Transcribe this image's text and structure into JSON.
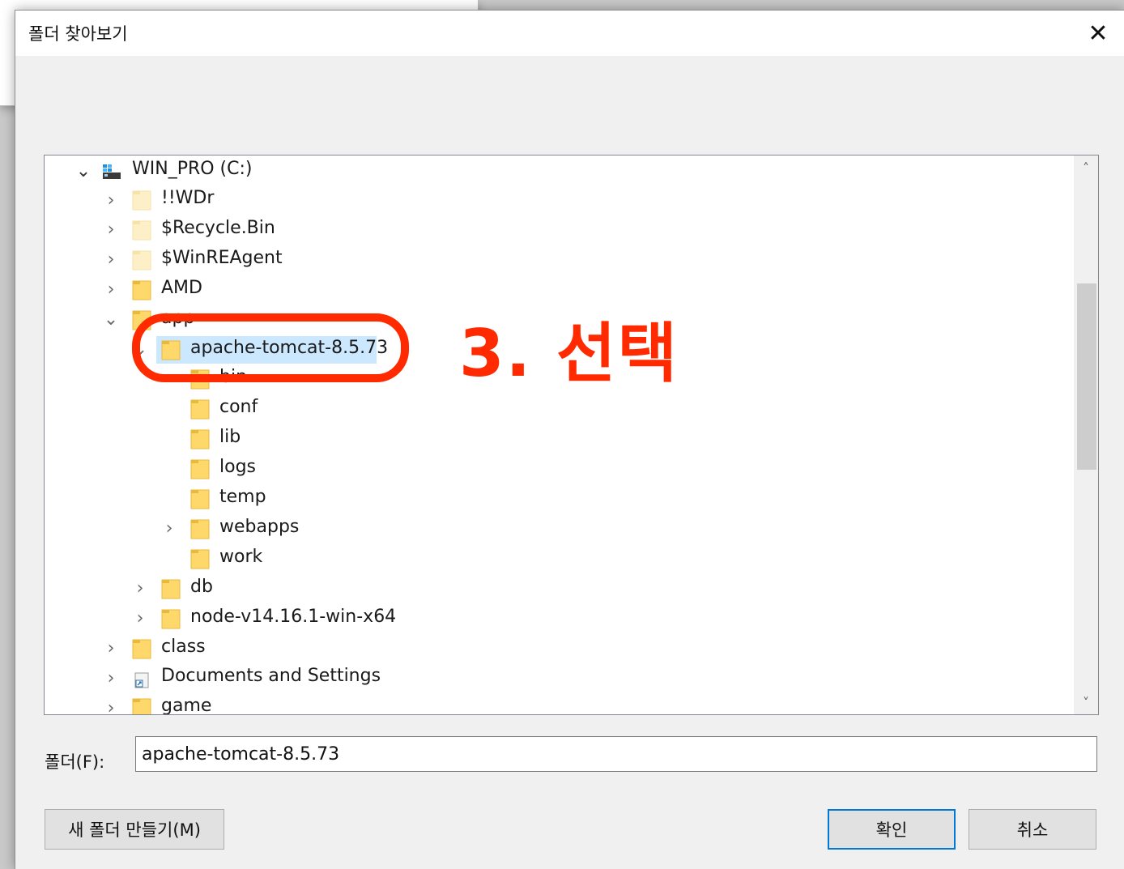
{
  "dialog": {
    "title": "폴더 찾아보기",
    "close_glyph": "✕"
  },
  "tree": {
    "drive": {
      "label": "WIN_PRO (C:)",
      "icon": "drive-icon"
    },
    "items": [
      {
        "label": "!!WDr",
        "expander": "›",
        "icon": "folder-hidden-icon"
      },
      {
        "label": "$Recycle.Bin",
        "expander": "›",
        "icon": "folder-hidden-icon"
      },
      {
        "label": "$WinREAgent",
        "expander": "›",
        "icon": "folder-hidden-icon"
      },
      {
        "label": "AMD",
        "expander": "›",
        "icon": "folder-icon"
      },
      {
        "label": "app",
        "expander": "⌄",
        "icon": "folder-icon"
      },
      {
        "label": "apache-tomcat-8.5.73",
        "expander": "⌄",
        "icon": "folder-icon",
        "selected": true
      },
      {
        "label": "bin",
        "expander": "",
        "icon": "folder-icon"
      },
      {
        "label": "conf",
        "expander": "",
        "icon": "folder-icon"
      },
      {
        "label": "lib",
        "expander": "",
        "icon": "folder-icon"
      },
      {
        "label": "logs",
        "expander": "",
        "icon": "folder-icon"
      },
      {
        "label": "temp",
        "expander": "",
        "icon": "folder-icon"
      },
      {
        "label": "webapps",
        "expander": "›",
        "icon": "folder-icon"
      },
      {
        "label": "work",
        "expander": "",
        "icon": "folder-icon"
      },
      {
        "label": "db",
        "expander": "›",
        "icon": "folder-icon"
      },
      {
        "label": "node-v14.16.1-win-x64",
        "expander": "›",
        "icon": "folder-icon"
      },
      {
        "label": "class",
        "expander": "›",
        "icon": "folder-icon"
      },
      {
        "label": "Documents and Settings",
        "expander": "›",
        "icon": "shortcut-folder-icon"
      },
      {
        "label": "game",
        "expander": "›",
        "icon": "folder-icon"
      }
    ],
    "scroll_up": "˄",
    "scroll_down": "˅"
  },
  "folder_field": {
    "label": "폴더(F):",
    "value": "apache-tomcat-8.5.73"
  },
  "buttons": {
    "new_folder": "새 폴더 만들기(M)",
    "ok": "확인",
    "cancel": "취소"
  },
  "annotation": {
    "text": "3. 선택",
    "color": "#ff2a00"
  },
  "colors": {
    "selection": "#cce8ff",
    "folder": "#ffd86b",
    "accent": "#0078d7"
  }
}
